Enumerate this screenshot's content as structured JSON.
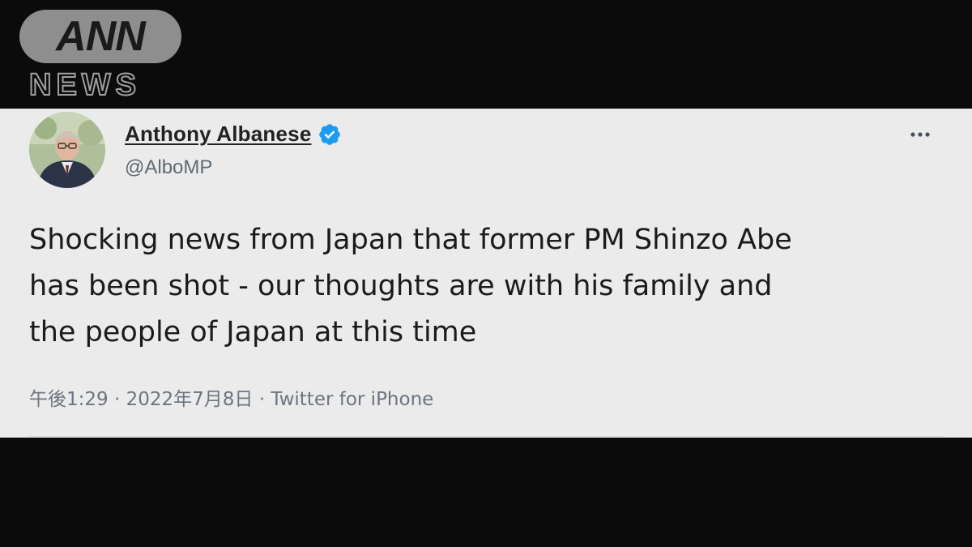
{
  "broadcaster": {
    "logo_top": "ANN",
    "logo_bottom": "NEWS"
  },
  "tweet": {
    "display_name": "Anthony Albanese",
    "handle": "@AlboMP",
    "verified": true,
    "verified_color": "#1d9bf0",
    "avatar_icon": "profile-photo",
    "more_icon": "ellipsis-icon",
    "text_lines": [
      "Shocking news from Japan that former PM Shinzo Abe",
      "has been shot - our thoughts are with his family and",
      "the people of Japan at this time"
    ],
    "time": "午後1:29",
    "date": "2022年7月8日",
    "source": "Twitter for iPhone",
    "separator": " · "
  },
  "colors": {
    "frame_background": "#0b0b0b",
    "card_background": "#ebebeb",
    "text": "#1b1b1b",
    "meta_text": "#6b7580"
  }
}
